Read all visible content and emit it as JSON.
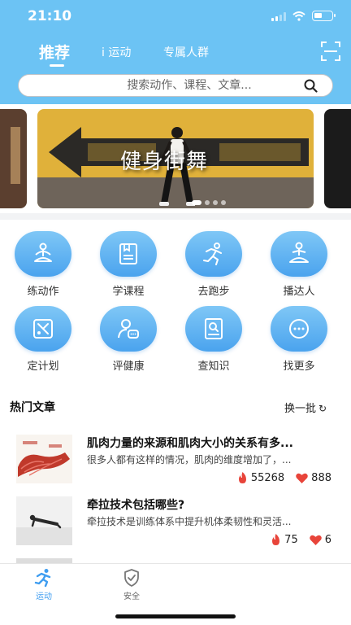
{
  "status_bar": {
    "time": "21:10"
  },
  "header": {
    "tabs": [
      {
        "label": "推荐"
      },
      {
        "label": "i 运动"
      },
      {
        "label": "专属人群"
      }
    ],
    "active_tab": "推荐"
  },
  "search": {
    "placeholder": "搜索动作、课程、文章..."
  },
  "banner": {
    "title": "健身街舞",
    "active_slide": 1,
    "slide_count": 4
  },
  "features": [
    {
      "label": "练动作",
      "icon": "meditation-icon"
    },
    {
      "label": "学课程",
      "icon": "course-book-icon"
    },
    {
      "label": "去跑步",
      "icon": "runner-icon"
    },
    {
      "label": "播达人",
      "icon": "meditation-person-icon"
    },
    {
      "label": "定计划",
      "icon": "plan-icon"
    },
    {
      "label": "评健康",
      "icon": "health-chat-icon"
    },
    {
      "label": "查知识",
      "icon": "knowledge-search-icon"
    },
    {
      "label": "找更多",
      "icon": "more-dots-icon"
    }
  ],
  "articles_section": {
    "heading": "热门文章",
    "refresh_label": "换一批",
    "items": [
      {
        "title": "肌肉力量的来源和肌肉大小的关系有多...",
        "summary": "很多人都有这样的情况，肌肉的维度增加了，...",
        "views": "55268",
        "likes": "888"
      },
      {
        "title": "牵拉技术包括哪些?",
        "summary": "牵拉技术是训练体系中提升机体柔韧性和灵活...",
        "views": "75",
        "likes": "6"
      }
    ]
  },
  "tabbar": {
    "items": [
      {
        "label": "运动",
        "icon": "runner-icon",
        "active": true
      },
      {
        "label": "安全",
        "icon": "shield-check-icon",
        "active": false
      }
    ]
  },
  "colors": {
    "header_blue": "#6cc3f4",
    "accent_blue": "#3f9df0",
    "flame_red": "#e8443a"
  }
}
